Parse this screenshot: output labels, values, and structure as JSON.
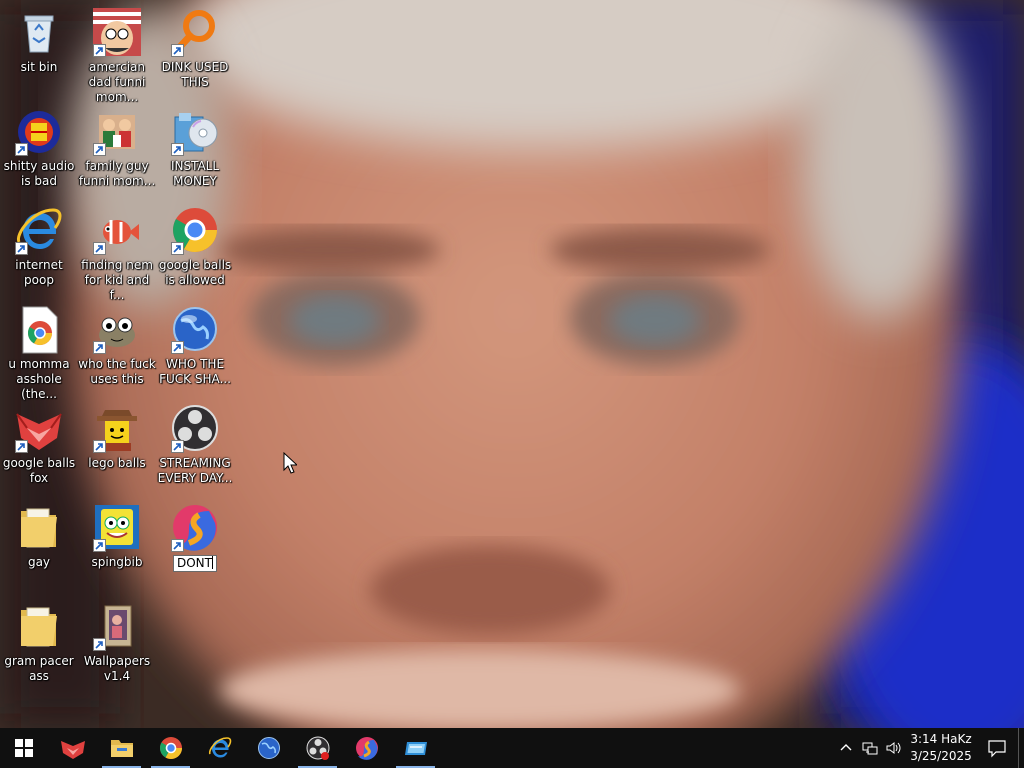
{
  "desktop": {
    "icons": [
      {
        "label": "sit bin",
        "icon": "recycle-bin-icon",
        "shortcut": false
      },
      {
        "label": "shitty audio is bad",
        "icon": "audio-app-icon",
        "shortcut": true
      },
      {
        "label": "internet poop",
        "icon": "internet-explorer-icon",
        "shortcut": true
      },
      {
        "label": "u momma asshole (the...",
        "icon": "chrome-document-icon",
        "shortcut": false
      },
      {
        "label": "google balls fox",
        "icon": "red-fox-browser-icon",
        "shortcut": true
      },
      {
        "label": "gay",
        "icon": "folder-icon",
        "shortcut": false
      },
      {
        "label": "gram pacer ass",
        "icon": "folder-icon",
        "shortcut": false
      },
      {
        "label": "amercian dad funni mom...",
        "icon": "cartoon-face-icon",
        "shortcut": true
      },
      {
        "label": "family guy funni mom...",
        "icon": "cartoon-group-icon",
        "shortcut": true
      },
      {
        "label": "finding nem for kid and f...",
        "icon": "fish-icon",
        "shortcut": true
      },
      {
        "label": "who the fuck uses this",
        "icon": "gimp-icon",
        "shortcut": true
      },
      {
        "label": "lego balls",
        "icon": "lego-figure-icon",
        "shortcut": true
      },
      {
        "label": "spingbib",
        "icon": "sponge-icon",
        "shortcut": true
      },
      {
        "label": "Wallpapers v1.4",
        "icon": "wallpaper-app-icon",
        "shortcut": true
      },
      {
        "label": "DINK USED THIS",
        "icon": "magnifier-app-icon",
        "shortcut": true
      },
      {
        "label": "INSTALL MONEY",
        "icon": "installer-icon",
        "shortcut": true
      },
      {
        "label": "google balls is allowed",
        "icon": "chrome-icon",
        "shortcut": true
      },
      {
        "label": "WHO THE FUCK SHA...",
        "icon": "globe-icon",
        "shortcut": true
      },
      {
        "label": "STREAMING EVERY DAY...",
        "icon": "obs-icon",
        "shortcut": true
      }
    ],
    "rename": {
      "value": "DONT",
      "icon": "swirl-app-icon"
    }
  },
  "taskbar": {
    "apps": [
      {
        "name": "red-fox-browser-icon",
        "running": false
      },
      {
        "name": "file-explorer-icon",
        "running": true
      },
      {
        "name": "chrome-icon",
        "running": true
      },
      {
        "name": "internet-explorer-icon",
        "running": false
      },
      {
        "name": "globe-icon",
        "running": false
      },
      {
        "name": "obs-icon",
        "running": true
      },
      {
        "name": "swirl-app-icon",
        "running": false
      },
      {
        "name": "window-app-icon",
        "running": true
      }
    ],
    "clock": {
      "time": "3:14 HaKz",
      "date": "3/25/2025"
    }
  },
  "colors": {
    "taskbar": "#101010",
    "accent": "#8ab4e8",
    "label": "#ffffff"
  }
}
